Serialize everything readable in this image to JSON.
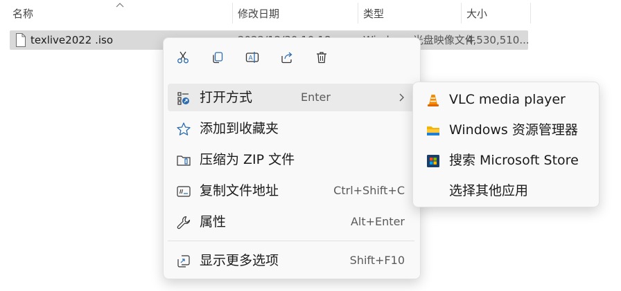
{
  "columns": {
    "name": "名称",
    "modified": "修改日期",
    "type": "类型",
    "size": "大小"
  },
  "file": {
    "name": "texlive2022 .iso",
    "modified_partial": "2022/12/30 10:18",
    "type_partial": "Windows 光盘映像文件",
    "size": "4,530,510..."
  },
  "context_menu": {
    "quick_actions": [
      "cut-icon",
      "copy-icon",
      "rename-icon",
      "share-icon",
      "delete-icon"
    ],
    "items": [
      {
        "label": "打开方式",
        "shortcut": "Enter",
        "icon": "open-with-icon"
      },
      {
        "label": "添加到收藏夹",
        "shortcut": "",
        "icon": "star-icon"
      },
      {
        "label": "压缩为 ZIP 文件",
        "shortcut": "",
        "icon": "zip-folder-icon"
      },
      {
        "label": "复制文件地址",
        "shortcut": "Ctrl+Shift+C",
        "icon": "copy-path-icon"
      },
      {
        "label": "属性",
        "shortcut": "Alt+Enter",
        "icon": "wrench-icon"
      },
      {
        "label": "显示更多选项",
        "shortcut": "Shift+F10",
        "icon": "more-options-icon"
      }
    ]
  },
  "submenu": {
    "items": [
      {
        "label": "VLC media player",
        "icon": "vlc-icon"
      },
      {
        "label": "Windows 资源管理器",
        "icon": "explorer-folder-icon"
      },
      {
        "label": "搜索 Microsoft Store",
        "icon": "store-icon"
      },
      {
        "label": "选择其他应用",
        "icon": ""
      }
    ]
  },
  "colors": {
    "selection": "#d9d9d9",
    "accent": "#0067c0",
    "menu_bg": "#f9f9f9"
  }
}
